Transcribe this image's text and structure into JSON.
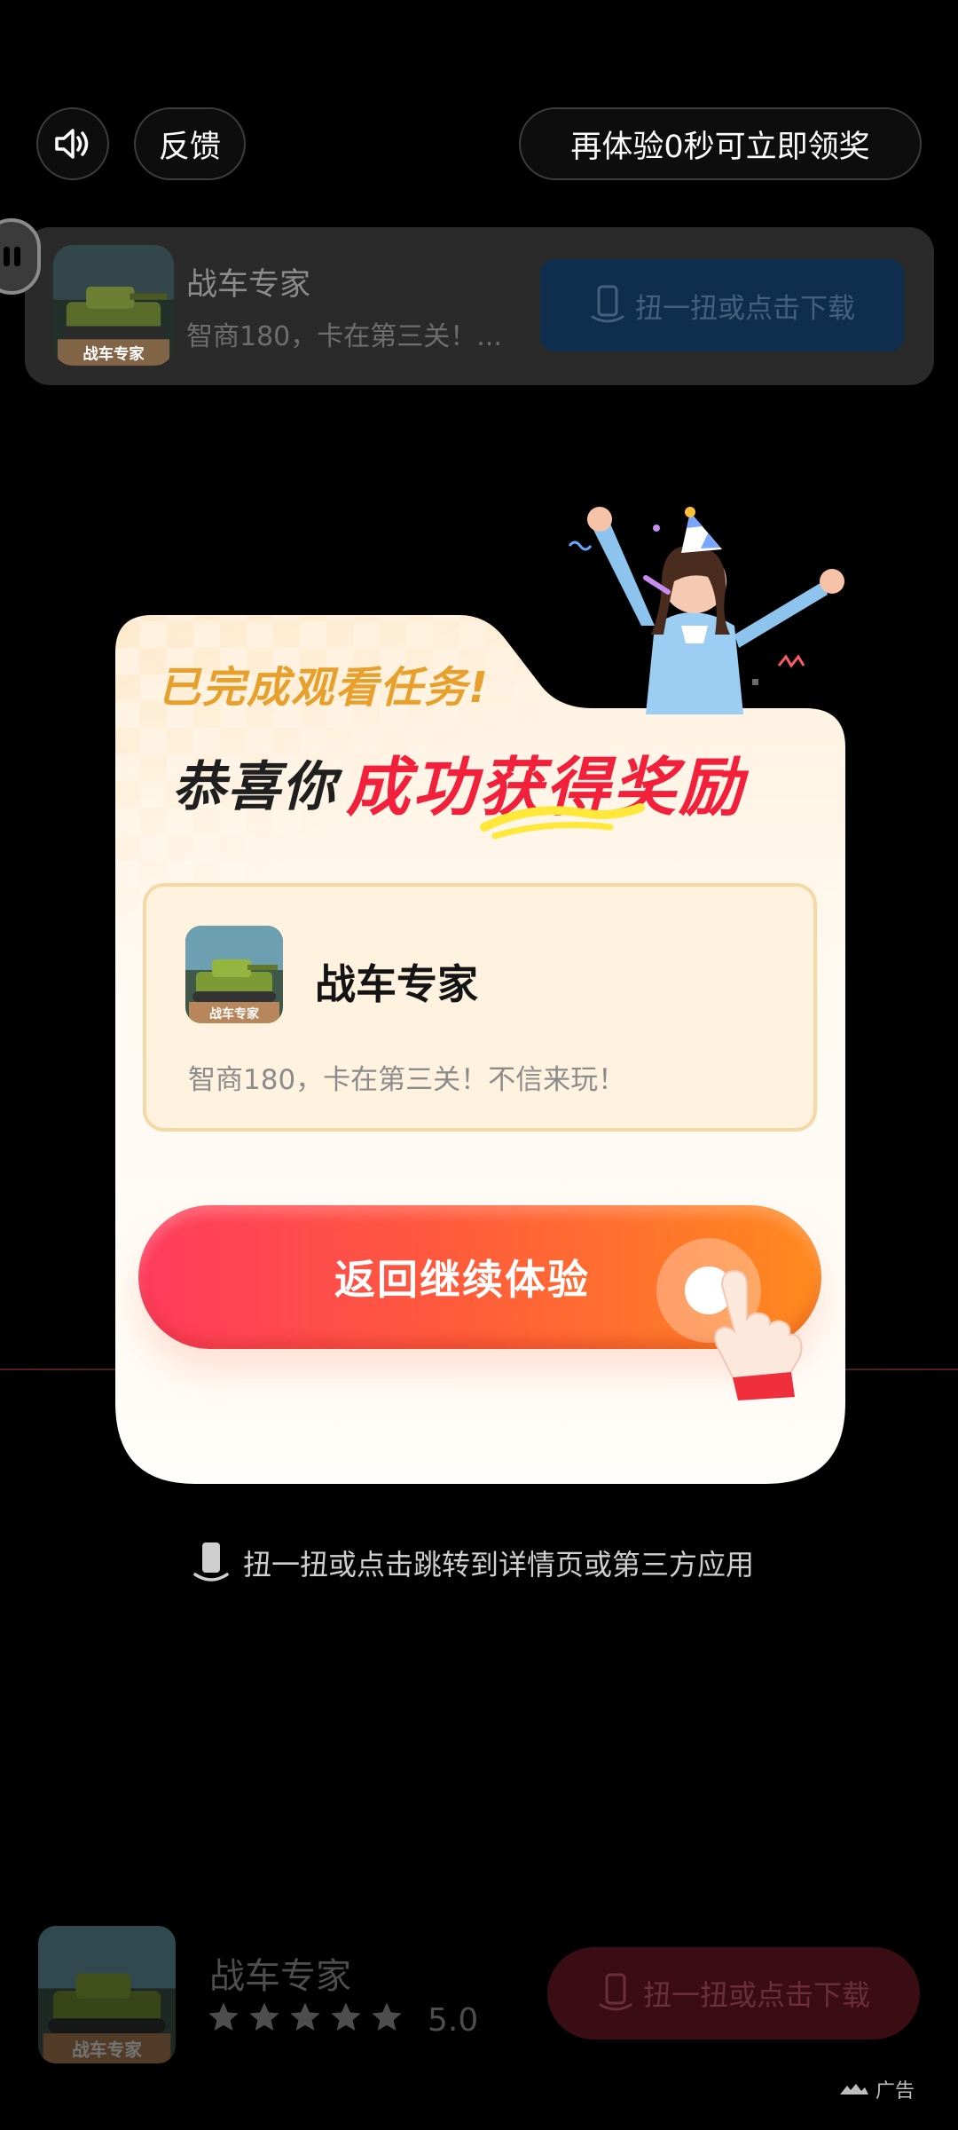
{
  "top_bar": {
    "feedback_label": "反馈",
    "reward_countdown": "再体验0秒可立即领奖"
  },
  "top_card": {
    "app_name": "战车专家",
    "app_desc": "智商180，卡在第三关！...",
    "download_label": "扭一扭或点击下载"
  },
  "dialog": {
    "task_done": "已完成观看任务!",
    "congrats_prefix": "恭喜你",
    "congrats_highlight": "成功获得奖励",
    "app_name": "战车专家",
    "app_desc": "智商180，卡在第三关！不信来玩！",
    "return_label": "返回继续体验"
  },
  "hint_text": "扭一扭或点击跳转到详情页或第三方应用",
  "bottom_bar": {
    "app_name": "战车专家",
    "rating": "5.0",
    "stars_filled": 5,
    "download_label": "扭一扭或点击下载"
  },
  "icon_text": "战车专家",
  "ad_label": "广告",
  "colors": {
    "accent_red": "#f2203a",
    "button_gradient_start": "#ff3b5e",
    "button_gradient_end": "#ff8a1e",
    "task_gold": "#e8a02c"
  }
}
